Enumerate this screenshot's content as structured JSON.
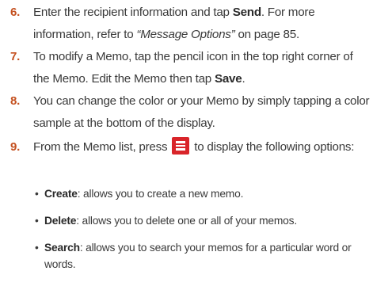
{
  "steps": [
    {
      "number": "6.",
      "part1": "Enter the recipient information and tap ",
      "bold1": "Send",
      "part2": ". For more information, refer to ",
      "ref": "“Message Options”",
      "part3": " on page 85."
    },
    {
      "number": "7.",
      "part1": "To modify a Memo, tap the pencil icon in the top right corner of the Memo. Edit the Memo then tap ",
      "bold1": "Save",
      "part2": "."
    },
    {
      "number": "8.",
      "part1": "You can change the color or your Memo by simply tapping a color sample at the bottom of the display."
    },
    {
      "number": "9.",
      "part1": "From the Memo list, press ",
      "icon": "menu-key-icon",
      "part2": " to display the following options:"
    }
  ],
  "options": [
    {
      "term": "Create",
      "desc": ": allows you to create a new memo."
    },
    {
      "term": "Delete",
      "desc": ": allows you to delete one or all of your memos."
    },
    {
      "term": "Search",
      "desc": ": allows you to search your memos for a particular word or words."
    }
  ],
  "colors": {
    "step_number": "#c4501f",
    "menu_key": "#d9252a",
    "body_text": "#3a3a3a"
  }
}
